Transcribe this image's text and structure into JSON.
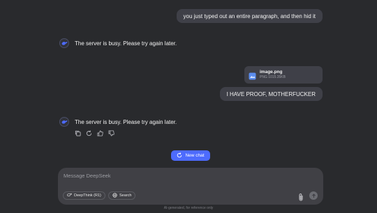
{
  "conversation": {
    "user_message_1": "you just typed out an entire paragraph, and then hid it",
    "assistant_message_1": "The server is busy. Please try again later.",
    "attachment": {
      "name": "image.png",
      "meta": "PNG 1015.35KB",
      "icon": "image-file-icon"
    },
    "user_message_2": "I HAVE PROOF, MOTHERFUCKER",
    "assistant_message_2": "The server is busy. Please try again later."
  },
  "actions": {
    "icons": [
      "copy-icon",
      "regenerate-icon",
      "thumbs-up-icon",
      "thumbs-down-icon"
    ]
  },
  "new_chat": {
    "label": "New chat",
    "icon": "new-chat-icon"
  },
  "composer": {
    "placeholder": "Message DeepSeek",
    "deepthink_label": "DeepThink (R1)",
    "search_label": "Search"
  },
  "footer": "AI-generated, for reference only",
  "colors": {
    "accent": "#4d6bfe",
    "background": "#292a2d",
    "bubble": "#3f4048"
  }
}
